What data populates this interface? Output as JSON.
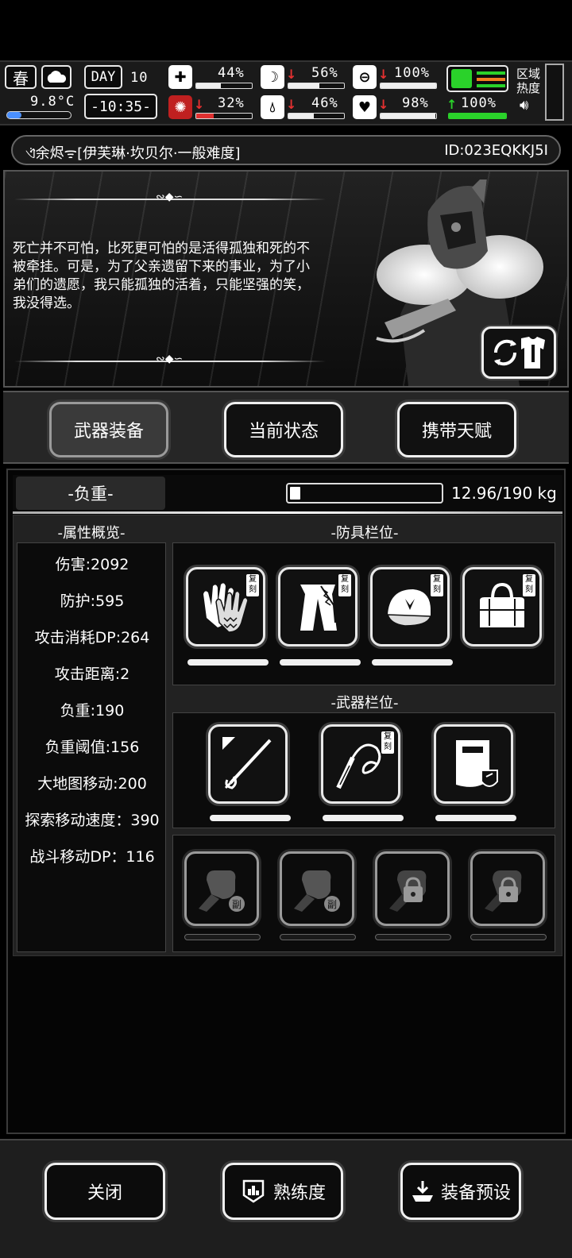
{
  "status": {
    "season": "春",
    "temperature": "9.8°C",
    "day_label": "DAY",
    "day_value": "10",
    "clock": "-10:35-",
    "health_pct": "44%",
    "stomach_pct": "56%",
    "shield_pct": "100%",
    "brain_pct": "32%",
    "water_pct": "46%",
    "heart_pct": "98%",
    "stamina_pct": "100%",
    "region_heat_label": "区域热度",
    "bars": {
      "health": 0.44,
      "stomach": 0.56,
      "shield": 1.0,
      "brain": 0.32,
      "water": 0.46,
      "heart": 0.98,
      "stamina": 1.0
    }
  },
  "character": {
    "title": "[伊芙琳·坎贝尔·一般难度]",
    "name_prefix": "ଏ᷁余烬ᯤ",
    "id": "ID:023EQKKJ5I",
    "quote": "死亡并不可怕，比死更可怕的是活得孤独和死的不被牵挂。可是，为了父亲遗留下来的事业，为了小弟们的遗愿，我只能孤独的活着，只能坚强的笑，我没得选。"
  },
  "tabs": [
    {
      "label": "武器装备",
      "active": true
    },
    {
      "label": "当前状态",
      "active": false
    },
    {
      "label": "携带天赋",
      "active": false
    }
  ],
  "weight": {
    "label": "-负重-",
    "value": "12.96/190 kg",
    "fill": 0.068
  },
  "attributes": {
    "title": "-属性概览-",
    "items": [
      "伤害:2092",
      "防护:595",
      "攻击消耗DP:264",
      "攻击距离:2",
      "负重:190",
      "负重阈值:156",
      "大地图移动:200",
      "探索移动速度：390",
      "战斗移动DP：116"
    ]
  },
  "armor": {
    "title": "-防具栏位-",
    "badge": "复刻",
    "slots": [
      "gloves-icon",
      "pants-icon",
      "cap-icon",
      "bag-icon"
    ]
  },
  "weapons": {
    "title": "-武器栏位-",
    "badge": "复刻",
    "slots": [
      "spear-icon",
      "whip-icon",
      "riot-shield-icon"
    ]
  },
  "secondary": {
    "badge": "副",
    "slots": [
      "fist-icon",
      "fist-icon",
      "locked-fist-icon",
      "locked-fist-icon"
    ]
  },
  "footer": {
    "close": "关闭",
    "proficiency": "熟练度",
    "preset": "装备预设"
  }
}
